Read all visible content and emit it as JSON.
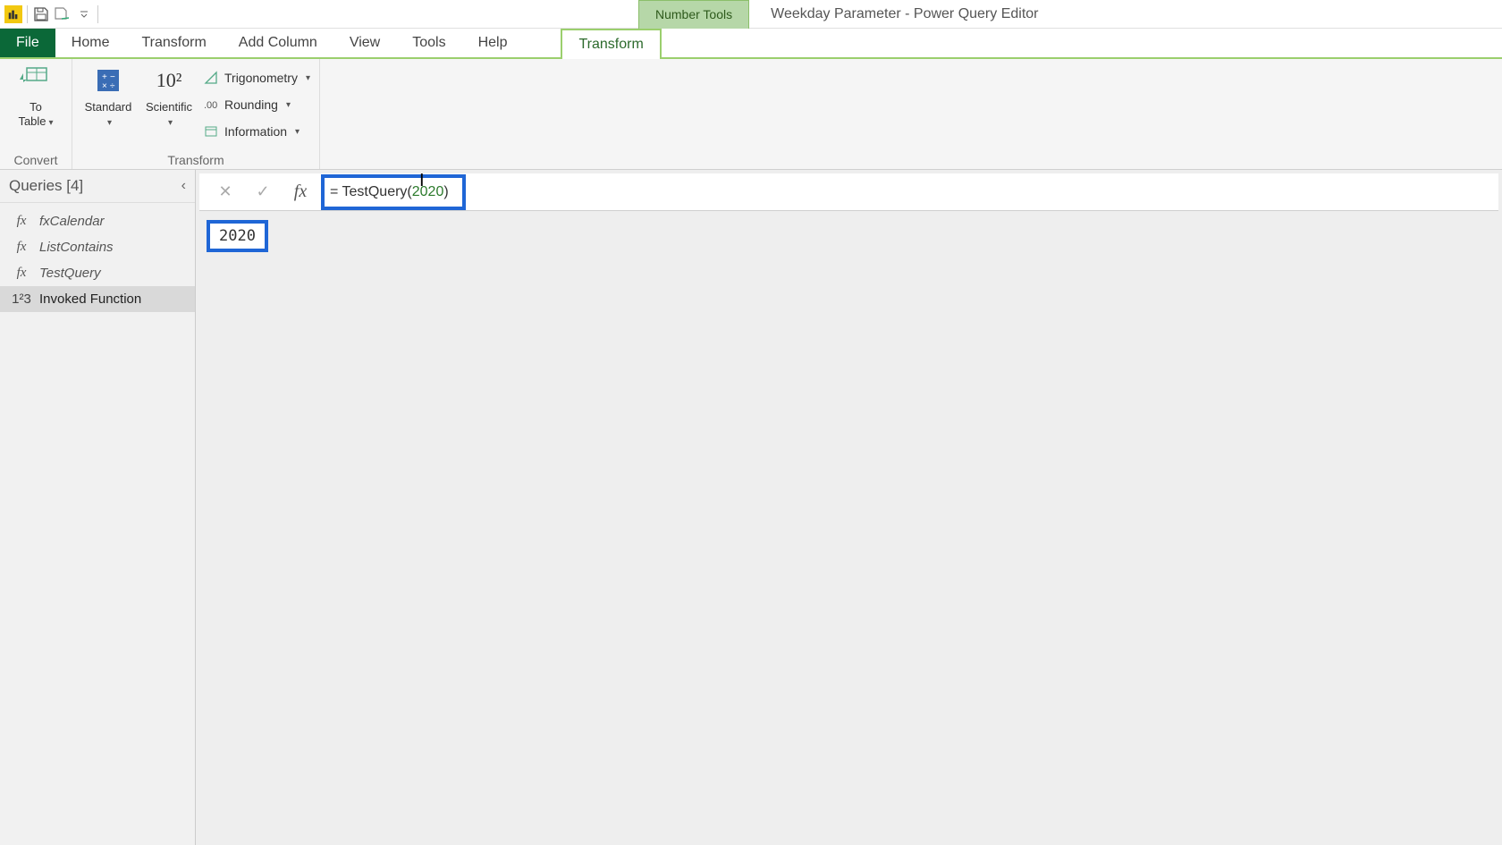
{
  "titleBar": {
    "contextGroup": "Number Tools",
    "windowTitle": "Weekday Parameter - Power Query Editor"
  },
  "tabs": {
    "file": "File",
    "home": "Home",
    "transform": "Transform",
    "addColumn": "Add Column",
    "view": "View",
    "tools": "Tools",
    "help": "Help",
    "contextTransform": "Transform"
  },
  "ribbon": {
    "group1": {
      "toTable": "To\nTable",
      "label": "Convert"
    },
    "group2": {
      "standard": "Standard",
      "scientific": "Scientific",
      "scientificIcon": "10²",
      "trig": "Trigonometry",
      "rounding": "Rounding",
      "information": "Information",
      "label": "Transform"
    }
  },
  "queriesPane": {
    "header": "Queries [4]",
    "items": [
      {
        "icon": "fx",
        "label": "fxCalendar"
      },
      {
        "icon": "fx",
        "label": "ListContains"
      },
      {
        "icon": "fx",
        "label": "TestQuery"
      },
      {
        "icon": "1²3",
        "label": "Invoked Function"
      }
    ]
  },
  "formulaBar": {
    "prefix": "= TestQuery(",
    "arg": "2020",
    "suffix": ")"
  },
  "preview": {
    "result": "2020"
  }
}
